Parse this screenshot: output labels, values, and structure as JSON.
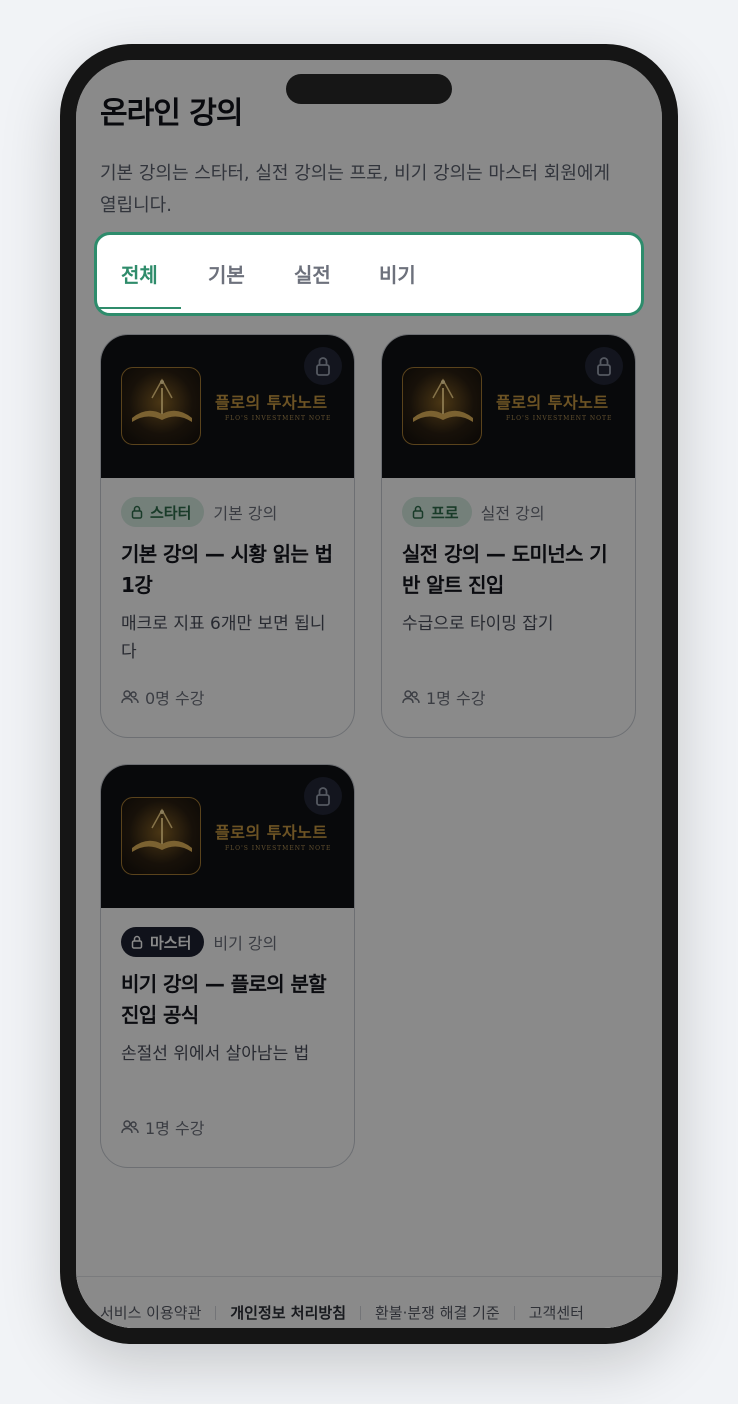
{
  "page": {
    "title": "온라인 강의",
    "description": "기본 강의는 스타터, 실전 강의는 프로, 비기 강의는 마스터 회원에게 열립니다."
  },
  "tabs": [
    {
      "label": "전체"
    },
    {
      "label": "기본"
    },
    {
      "label": "실전"
    },
    {
      "label": "비기"
    }
  ],
  "brand": {
    "title_ko": "플로의 투자노트",
    "title_en": "FLO'S INVESTMENT NOTE"
  },
  "courses": [
    {
      "badge": "스타터",
      "type": "기본 강의",
      "title": "기본 강의 — 시황 읽는 법 1강",
      "subtitle": "매크로 지표 6개만 보면 됩니다",
      "count": "0명 수강"
    },
    {
      "badge": "프로",
      "type": "실전 강의",
      "title": "실전 강의 — 도미넌스 기반 알트 진입",
      "subtitle": "수급으로 타이밍 잡기",
      "count": "1명 수강"
    },
    {
      "badge": "마스터",
      "type": "비기 강의",
      "title": "비기 강의 — 플로의 분할 진입 공식",
      "subtitle": "손절선 위에서 살아남는 법",
      "count": "1명 수강"
    }
  ],
  "footer": {
    "links": [
      "서비스 이용약관",
      "개인정보 처리방침",
      "환불·분쟁 해결 기준",
      "고객센터"
    ]
  },
  "colors": {
    "accent": "#2f8c6b",
    "overlay": "rgba(0,0,0,0.46)"
  },
  "icons": {
    "lock": "lock-icon",
    "users": "users-icon"
  }
}
